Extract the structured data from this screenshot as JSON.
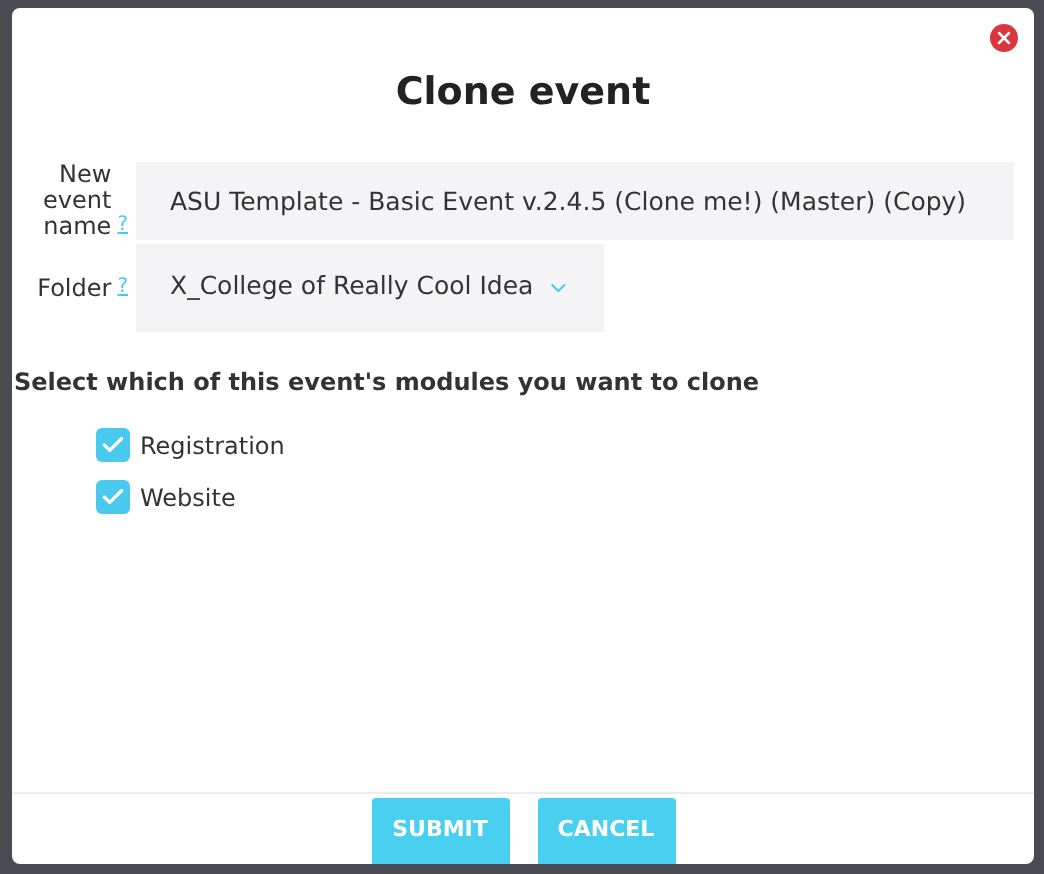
{
  "dialog": {
    "title": "Clone event",
    "fields": [
      {
        "kind": "text",
        "label": "New event name",
        "help": "?",
        "value": "ASU Template - Basic Event v.2.4.5 (Clone me!) (Master) (Copy)"
      },
      {
        "kind": "select",
        "label": "Folder",
        "help": "?",
        "value": "X_College of Really Cool Idea"
      }
    ],
    "modules_prompt": "Select which of this event's modules you want to clone",
    "modules": [
      {
        "label": "Registration",
        "checked": true
      },
      {
        "label": "Website",
        "checked": true
      }
    ],
    "buttons": [
      "SUBMIT",
      "CANCEL"
    ]
  }
}
